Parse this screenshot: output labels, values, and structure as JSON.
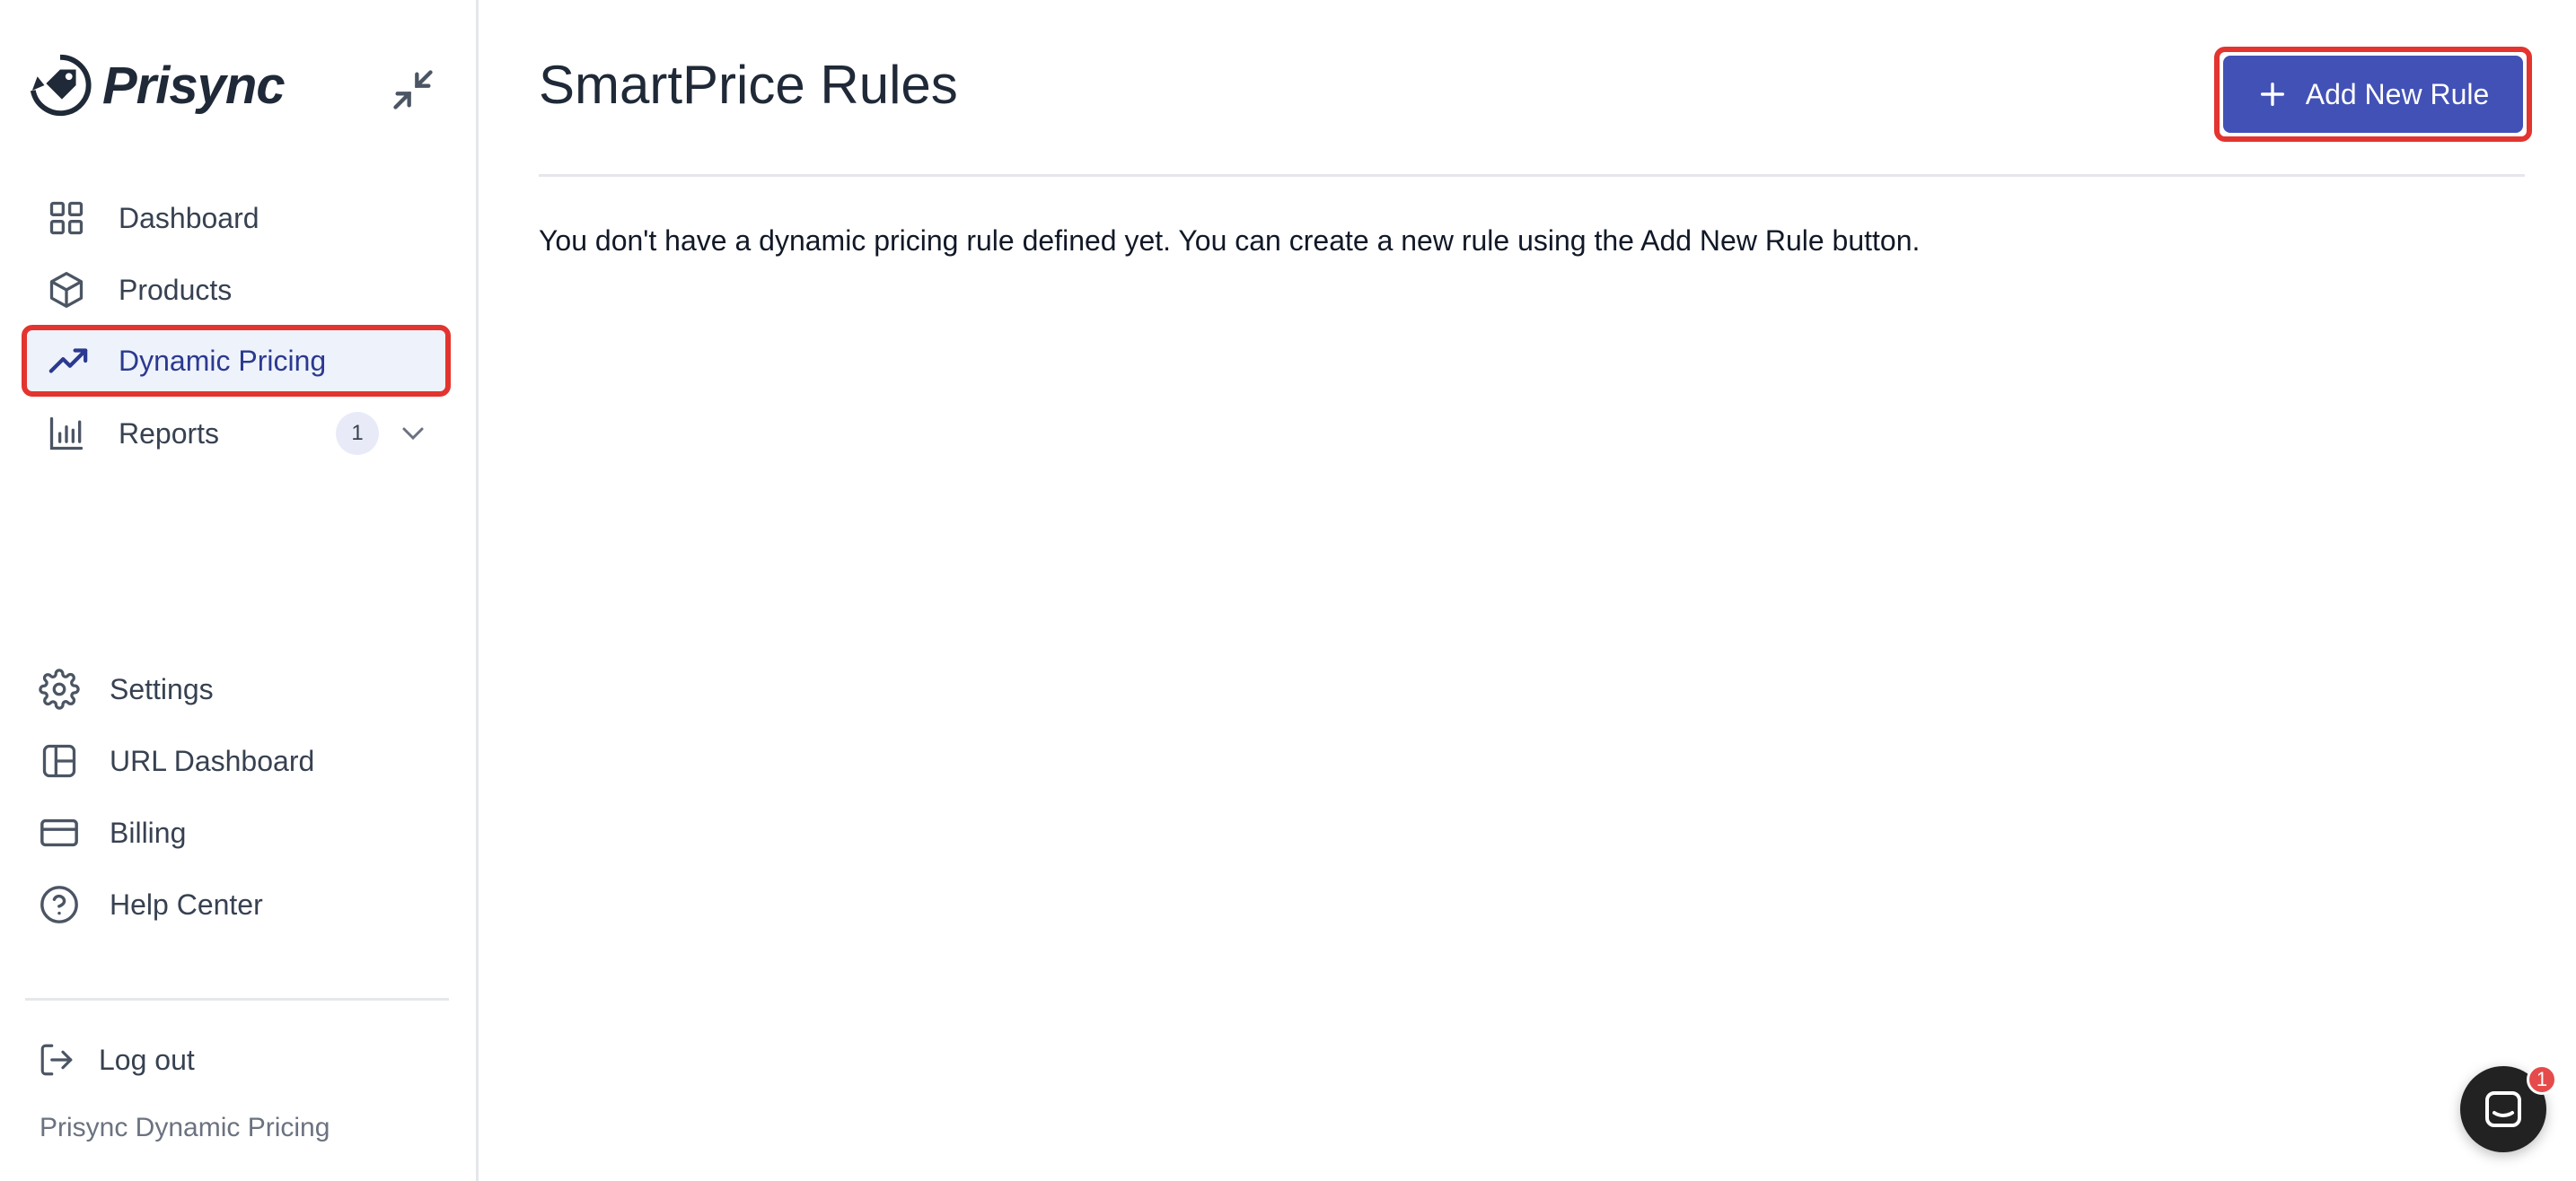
{
  "brand": {
    "name": "Prisync"
  },
  "sidebar": {
    "items": [
      {
        "label": "Dashboard",
        "icon": "grid-icon"
      },
      {
        "label": "Products",
        "icon": "cube-icon"
      },
      {
        "label": "Dynamic Pricing",
        "icon": "trending-up-icon",
        "active": true
      },
      {
        "label": "Reports",
        "icon": "bar-chart-icon",
        "badge": "1"
      }
    ],
    "bottom_items": [
      {
        "label": "Settings",
        "icon": "gear-icon"
      },
      {
        "label": "URL Dashboard",
        "icon": "layout-icon"
      },
      {
        "label": "Billing",
        "icon": "credit-card-icon"
      },
      {
        "label": "Help Center",
        "icon": "help-circle-icon"
      }
    ],
    "logout_label": "Log out",
    "footer_text": "Prisync Dynamic Pricing"
  },
  "main": {
    "title": "SmartPrice Rules",
    "add_button_label": "Add New Rule",
    "empty_message": "You don't have a dynamic pricing rule defined yet. You can create a new rule using the Add New Rule button."
  },
  "chat": {
    "badge": "1"
  },
  "colors": {
    "accent": "#4251b5",
    "highlight": "#e3342f",
    "active_bg": "#eef2fb",
    "active_text": "#2b3a8f"
  }
}
